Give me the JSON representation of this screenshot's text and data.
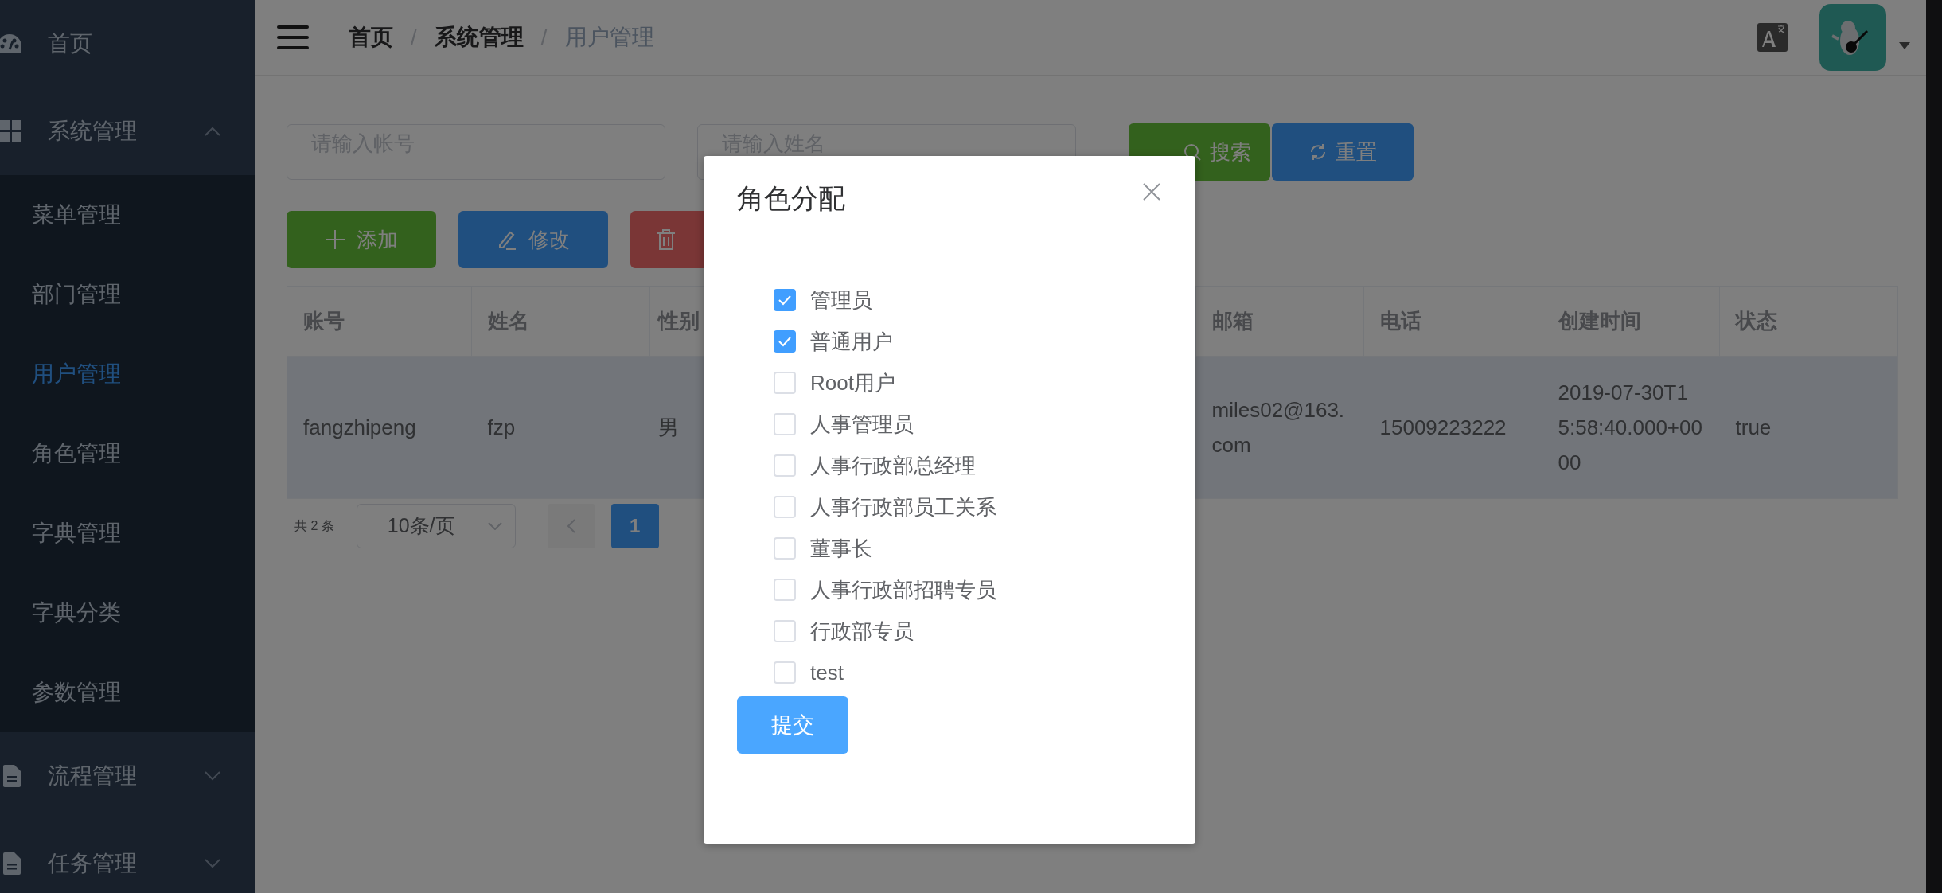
{
  "sidebar": {
    "items": [
      {
        "label": "首页",
        "selected": false
      },
      {
        "label": "系统管理",
        "expanded": true,
        "selected": false,
        "children": [
          {
            "label": "菜单管理",
            "selected": false
          },
          {
            "label": "部门管理",
            "selected": false
          },
          {
            "label": "用户管理",
            "selected": true
          },
          {
            "label": "角色管理",
            "selected": false
          },
          {
            "label": "字典管理",
            "selected": false
          },
          {
            "label": "字典分类",
            "selected": false
          },
          {
            "label": "参数管理",
            "selected": false
          }
        ]
      },
      {
        "label": "流程管理",
        "expanded": false,
        "selected": false
      },
      {
        "label": "任务管理",
        "expanded": false,
        "selected": false
      }
    ]
  },
  "breadcrumb": [
    {
      "label": "首页"
    },
    {
      "separator": "/",
      "label": "系统管理"
    },
    {
      "separator": "/",
      "label": "用户管理"
    }
  ],
  "search": {
    "fields": [
      {
        "placeholder": "请输入帐号"
      },
      {
        "placeholder": "请输入姓名"
      }
    ],
    "buttons": [
      {
        "label": "搜索",
        "kind": "search"
      },
      {
        "label": "重置",
        "kind": "reset"
      }
    ]
  },
  "actions": [
    {
      "label": "添加",
      "kind": "add"
    },
    {
      "label": "修改",
      "kind": "edit"
    },
    {
      "kind": "delete"
    }
  ],
  "table": {
    "columns": [
      "账号",
      "姓名",
      "性别",
      "",
      "邮箱",
      "电话",
      "创建时间",
      "状态"
    ],
    "rows": [
      {
        "selected": true,
        "cells": [
          "fangzhipeng",
          "fzp",
          "男",
          "",
          "miles02@163.com",
          "15009223222",
          "2019-07-30T15:58:40.000+0000",
          "true"
        ]
      }
    ]
  },
  "pagination": {
    "total": "共 2 条",
    "page_size": "10条/页",
    "pages": [
      {
        "label": "1",
        "selected": true
      }
    ]
  },
  "dialog": {
    "title": "角色分配",
    "roles": [
      {
        "label": "管理员",
        "checked": true
      },
      {
        "label": "普通用户",
        "checked": true
      },
      {
        "label": "Root用户",
        "checked": false
      },
      {
        "label": "人事管理员",
        "checked": false
      },
      {
        "label": "人事行政部总经理",
        "checked": false
      },
      {
        "label": "人事行政部员工关系",
        "checked": false
      },
      {
        "label": "董事长",
        "checked": false
      },
      {
        "label": "人事行政部招聘专员",
        "checked": false
      },
      {
        "label": "行政部专员",
        "checked": false
      },
      {
        "label": "test",
        "checked": false
      }
    ],
    "submit": "提交"
  }
}
